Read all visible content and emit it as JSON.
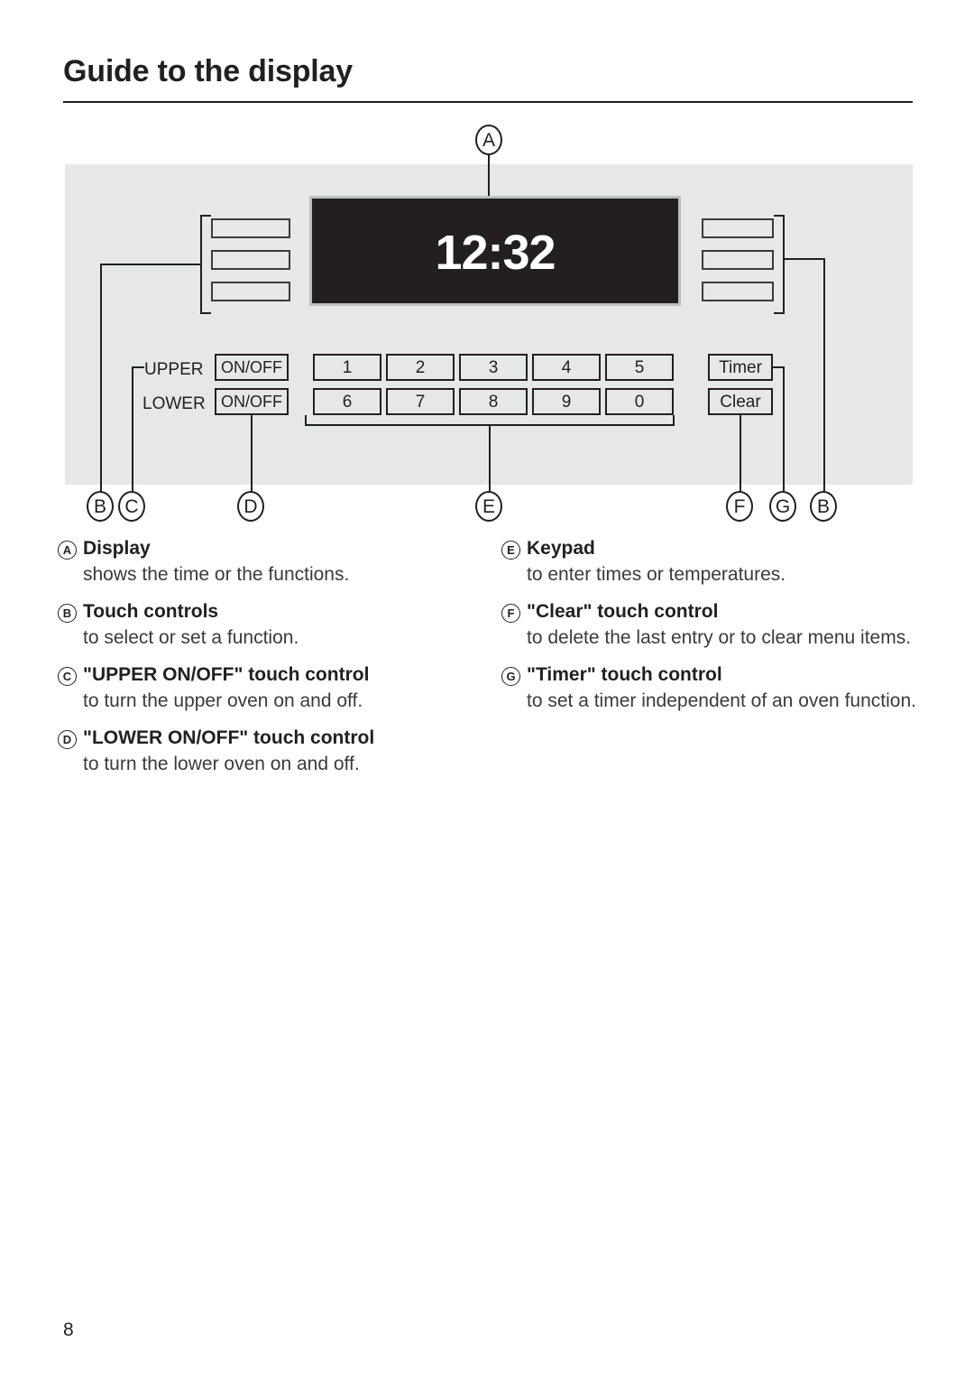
{
  "document": {
    "heading": "Guide to the display",
    "page_number": "8"
  },
  "figure": {
    "display": {
      "value": "12:32"
    },
    "labels": {
      "upper": "UPPER",
      "lower": "LOWER",
      "upper_onoff": "ON/OFF",
      "lower_onoff": "ON/OFF",
      "timer": "Timer",
      "clear": "Clear"
    },
    "keypad": {
      "row1": [
        "1",
        "2",
        "3",
        "4",
        "5"
      ],
      "row2": [
        "6",
        "7",
        "8",
        "9",
        "0"
      ]
    },
    "callouts": {
      "a": "A",
      "b_left": "B",
      "c": "C",
      "d": "D",
      "e": "E",
      "f": "F",
      "g": "G",
      "b_right": "B"
    }
  },
  "legend": {
    "left": [
      {
        "letter": "A",
        "title": "Display",
        "body": "shows the time or the functions."
      },
      {
        "letter": "B",
        "title": "Touch controls",
        "body": "to select or set a function."
      },
      {
        "letter": "C",
        "title": "\"UPPER ON/OFF\" touch control",
        "body": "to turn the upper oven on and off."
      },
      {
        "letter": "D",
        "title": "\"LOWER ON/OFF\" touch control",
        "body": "to turn the lower oven on and off."
      }
    ],
    "right": [
      {
        "letter": "E",
        "title": "Keypad",
        "body": "to enter times or temperatures."
      },
      {
        "letter": "F",
        "title": "\"Clear\" touch control",
        "body": "to delete the last entry or to clear menu items."
      },
      {
        "letter": "G",
        "title": "\"Timer\" touch control",
        "body": "to set a timer independent of an oven function."
      }
    ]
  },
  "colors": {
    "ink": "#231f20",
    "panel_bg": "#e6e7e8",
    "display_bg": "#231f20",
    "display_text": "#ffffff"
  }
}
